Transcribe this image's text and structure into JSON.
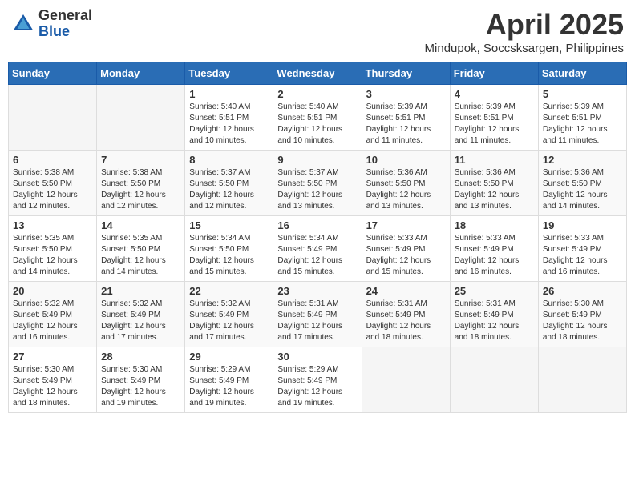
{
  "header": {
    "logo_general": "General",
    "logo_blue": "Blue",
    "month_year": "April 2025",
    "location": "Mindupok, Soccsksargen, Philippines"
  },
  "weekdays": [
    "Sunday",
    "Monday",
    "Tuesday",
    "Wednesday",
    "Thursday",
    "Friday",
    "Saturday"
  ],
  "weeks": [
    [
      {
        "day": "",
        "info": ""
      },
      {
        "day": "",
        "info": ""
      },
      {
        "day": "1",
        "info": "Sunrise: 5:40 AM\nSunset: 5:51 PM\nDaylight: 12 hours and 10 minutes."
      },
      {
        "day": "2",
        "info": "Sunrise: 5:40 AM\nSunset: 5:51 PM\nDaylight: 12 hours and 10 minutes."
      },
      {
        "day": "3",
        "info": "Sunrise: 5:39 AM\nSunset: 5:51 PM\nDaylight: 12 hours and 11 minutes."
      },
      {
        "day": "4",
        "info": "Sunrise: 5:39 AM\nSunset: 5:51 PM\nDaylight: 12 hours and 11 minutes."
      },
      {
        "day": "5",
        "info": "Sunrise: 5:39 AM\nSunset: 5:51 PM\nDaylight: 12 hours and 11 minutes."
      }
    ],
    [
      {
        "day": "6",
        "info": "Sunrise: 5:38 AM\nSunset: 5:50 PM\nDaylight: 12 hours and 12 minutes."
      },
      {
        "day": "7",
        "info": "Sunrise: 5:38 AM\nSunset: 5:50 PM\nDaylight: 12 hours and 12 minutes."
      },
      {
        "day": "8",
        "info": "Sunrise: 5:37 AM\nSunset: 5:50 PM\nDaylight: 12 hours and 12 minutes."
      },
      {
        "day": "9",
        "info": "Sunrise: 5:37 AM\nSunset: 5:50 PM\nDaylight: 12 hours and 13 minutes."
      },
      {
        "day": "10",
        "info": "Sunrise: 5:36 AM\nSunset: 5:50 PM\nDaylight: 12 hours and 13 minutes."
      },
      {
        "day": "11",
        "info": "Sunrise: 5:36 AM\nSunset: 5:50 PM\nDaylight: 12 hours and 13 minutes."
      },
      {
        "day": "12",
        "info": "Sunrise: 5:36 AM\nSunset: 5:50 PM\nDaylight: 12 hours and 14 minutes."
      }
    ],
    [
      {
        "day": "13",
        "info": "Sunrise: 5:35 AM\nSunset: 5:50 PM\nDaylight: 12 hours and 14 minutes."
      },
      {
        "day": "14",
        "info": "Sunrise: 5:35 AM\nSunset: 5:50 PM\nDaylight: 12 hours and 14 minutes."
      },
      {
        "day": "15",
        "info": "Sunrise: 5:34 AM\nSunset: 5:50 PM\nDaylight: 12 hours and 15 minutes."
      },
      {
        "day": "16",
        "info": "Sunrise: 5:34 AM\nSunset: 5:49 PM\nDaylight: 12 hours and 15 minutes."
      },
      {
        "day": "17",
        "info": "Sunrise: 5:33 AM\nSunset: 5:49 PM\nDaylight: 12 hours and 15 minutes."
      },
      {
        "day": "18",
        "info": "Sunrise: 5:33 AM\nSunset: 5:49 PM\nDaylight: 12 hours and 16 minutes."
      },
      {
        "day": "19",
        "info": "Sunrise: 5:33 AM\nSunset: 5:49 PM\nDaylight: 12 hours and 16 minutes."
      }
    ],
    [
      {
        "day": "20",
        "info": "Sunrise: 5:32 AM\nSunset: 5:49 PM\nDaylight: 12 hours and 16 minutes."
      },
      {
        "day": "21",
        "info": "Sunrise: 5:32 AM\nSunset: 5:49 PM\nDaylight: 12 hours and 17 minutes."
      },
      {
        "day": "22",
        "info": "Sunrise: 5:32 AM\nSunset: 5:49 PM\nDaylight: 12 hours and 17 minutes."
      },
      {
        "day": "23",
        "info": "Sunrise: 5:31 AM\nSunset: 5:49 PM\nDaylight: 12 hours and 17 minutes."
      },
      {
        "day": "24",
        "info": "Sunrise: 5:31 AM\nSunset: 5:49 PM\nDaylight: 12 hours and 18 minutes."
      },
      {
        "day": "25",
        "info": "Sunrise: 5:31 AM\nSunset: 5:49 PM\nDaylight: 12 hours and 18 minutes."
      },
      {
        "day": "26",
        "info": "Sunrise: 5:30 AM\nSunset: 5:49 PM\nDaylight: 12 hours and 18 minutes."
      }
    ],
    [
      {
        "day": "27",
        "info": "Sunrise: 5:30 AM\nSunset: 5:49 PM\nDaylight: 12 hours and 18 minutes."
      },
      {
        "day": "28",
        "info": "Sunrise: 5:30 AM\nSunset: 5:49 PM\nDaylight: 12 hours and 19 minutes."
      },
      {
        "day": "29",
        "info": "Sunrise: 5:29 AM\nSunset: 5:49 PM\nDaylight: 12 hours and 19 minutes."
      },
      {
        "day": "30",
        "info": "Sunrise: 5:29 AM\nSunset: 5:49 PM\nDaylight: 12 hours and 19 minutes."
      },
      {
        "day": "",
        "info": ""
      },
      {
        "day": "",
        "info": ""
      },
      {
        "day": "",
        "info": ""
      }
    ]
  ]
}
